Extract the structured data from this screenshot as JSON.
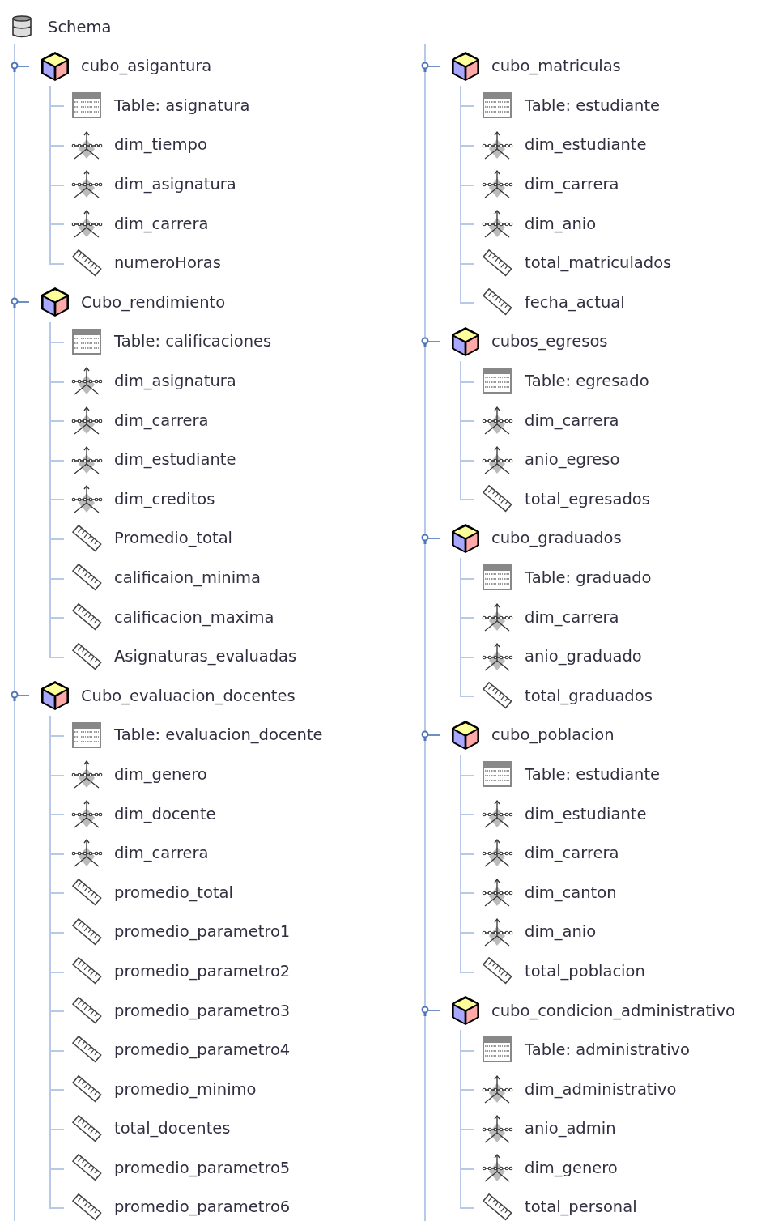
{
  "root": {
    "label": "Schema"
  },
  "columns": [
    [
      {
        "label": "cubo_asigantura",
        "expanded": true,
        "children": [
          {
            "kind": "table",
            "label": "Table: asignatura"
          },
          {
            "kind": "dimension",
            "label": "dim_tiempo"
          },
          {
            "kind": "dimension",
            "label": "dim_asignatura"
          },
          {
            "kind": "dimension",
            "label": "dim_carrera"
          },
          {
            "kind": "measure",
            "label": "numeroHoras"
          }
        ]
      },
      {
        "label": "Cubo_rendimiento",
        "expanded": true,
        "children": [
          {
            "kind": "table",
            "label": "Table: calificaciones"
          },
          {
            "kind": "dimension",
            "label": "dim_asignatura"
          },
          {
            "kind": "dimension",
            "label": "dim_carrera"
          },
          {
            "kind": "dimension",
            "label": "dim_estudiante"
          },
          {
            "kind": "dimension",
            "label": "dim_creditos"
          },
          {
            "kind": "measure",
            "label": "Promedio_total"
          },
          {
            "kind": "measure",
            "label": "calificaion_minima"
          },
          {
            "kind": "measure",
            "label": "calificacion_maxima"
          },
          {
            "kind": "measure",
            "label": "Asignaturas_evaluadas"
          }
        ]
      },
      {
        "label": "Cubo_evaluacion_docentes",
        "expanded": true,
        "children": [
          {
            "kind": "table",
            "label": "Table: evaluacion_docente"
          },
          {
            "kind": "dimension",
            "label": "dim_genero"
          },
          {
            "kind": "dimension",
            "label": "dim_docente"
          },
          {
            "kind": "dimension",
            "label": "dim_carrera"
          },
          {
            "kind": "measure",
            "label": "promedio_total"
          },
          {
            "kind": "measure",
            "label": "promedio_parametro1"
          },
          {
            "kind": "measure",
            "label": "promedio_parametro2"
          },
          {
            "kind": "measure",
            "label": "promedio_parametro3"
          },
          {
            "kind": "measure",
            "label": "promedio_parametro4"
          },
          {
            "kind": "measure",
            "label": "promedio_minimo"
          },
          {
            "kind": "measure",
            "label": "total_docentes"
          },
          {
            "kind": "measure",
            "label": "promedio_parametro5"
          },
          {
            "kind": "measure",
            "label": "promedio_parametro6"
          }
        ]
      }
    ],
    [
      {
        "label": "cubo_matriculas",
        "expanded": true,
        "children": [
          {
            "kind": "table",
            "label": "Table: estudiante"
          },
          {
            "kind": "dimension",
            "label": "dim_estudiante"
          },
          {
            "kind": "dimension",
            "label": "dim_carrera"
          },
          {
            "kind": "dimension",
            "label": "dim_anio"
          },
          {
            "kind": "measure",
            "label": "total_matriculados"
          },
          {
            "kind": "measure",
            "label": "fecha_actual"
          }
        ]
      },
      {
        "label": "cubos_egresos",
        "expanded": true,
        "children": [
          {
            "kind": "table",
            "label": "Table: egresado"
          },
          {
            "kind": "dimension",
            "label": "dim_carrera"
          },
          {
            "kind": "dimension",
            "label": "anio_egreso"
          },
          {
            "kind": "measure",
            "label": "total_egresados"
          }
        ]
      },
      {
        "label": "cubo_graduados",
        "expanded": true,
        "children": [
          {
            "kind": "table",
            "label": "Table: graduado"
          },
          {
            "kind": "dimension",
            "label": "dim_carrera"
          },
          {
            "kind": "dimension",
            "label": "anio_graduado"
          },
          {
            "kind": "measure",
            "label": "total_graduados"
          }
        ]
      },
      {
        "label": "cubo_poblacion",
        "expanded": true,
        "children": [
          {
            "kind": "table",
            "label": "Table: estudiante"
          },
          {
            "kind": "dimension",
            "label": "dim_estudiante"
          },
          {
            "kind": "dimension",
            "label": "dim_carrera"
          },
          {
            "kind": "dimension",
            "label": "dim_canton"
          },
          {
            "kind": "dimension",
            "label": "dim_anio"
          },
          {
            "kind": "measure",
            "label": "total_poblacion"
          }
        ]
      },
      {
        "label": "cubo_condicion_administrativo",
        "expanded": true,
        "children": [
          {
            "kind": "table",
            "label": "Table: administrativo"
          },
          {
            "kind": "dimension",
            "label": "dim_administrativo"
          },
          {
            "kind": "dimension",
            "label": "anio_admin"
          },
          {
            "kind": "dimension",
            "label": "dim_genero"
          },
          {
            "kind": "measure",
            "label": "total_personal"
          }
        ]
      }
    ]
  ]
}
